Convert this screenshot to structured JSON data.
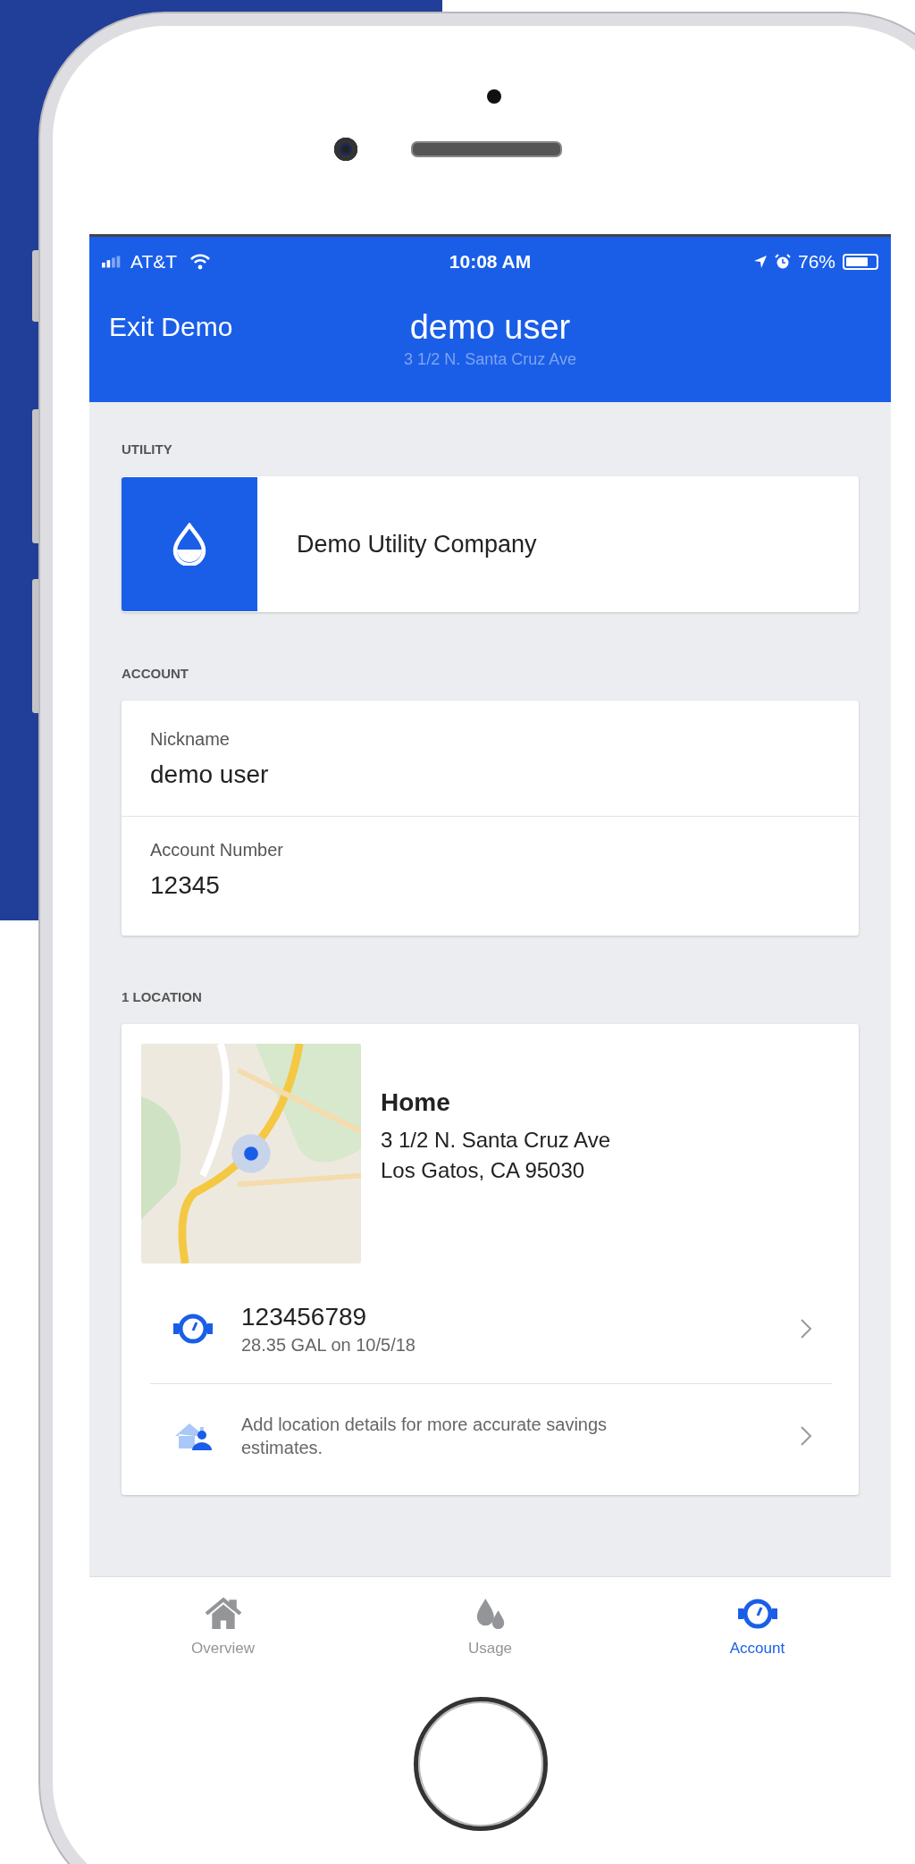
{
  "status_bar": {
    "carrier": "AT&T",
    "time": "10:08 AM",
    "battery": {
      "text": "76%",
      "level": 0.76
    }
  },
  "header": {
    "left_action": "Exit Demo",
    "title": "demo user",
    "subtitle": "3 1/2 N. Santa Cruz Ave"
  },
  "utility": {
    "heading": "UTILITY",
    "name": "Demo Utility Company"
  },
  "account": {
    "heading": "ACCOUNT",
    "fields": [
      {
        "label": "Nickname",
        "value": "demo user"
      },
      {
        "label": "Account Number",
        "value": "12345"
      }
    ]
  },
  "locations": {
    "heading": "1 LOCATION",
    "items": [
      {
        "name": "Home",
        "address_lines": [
          "3 1/2 N. Santa Cruz Ave",
          "Los Gatos, CA 95030"
        ],
        "rows": [
          {
            "kind": "meter",
            "title": "123456789",
            "subtitle": "28.35 GAL on 10/5/18"
          },
          {
            "kind": "details",
            "text": "Add location details for more accurate savings estimates."
          }
        ]
      }
    ]
  },
  "tabs": [
    {
      "kind": "overview",
      "label": "Overview",
      "selected": false
    },
    {
      "kind": "usage",
      "label": "Usage",
      "selected": false
    },
    {
      "kind": "account",
      "label": "Account",
      "selected": true
    }
  ]
}
